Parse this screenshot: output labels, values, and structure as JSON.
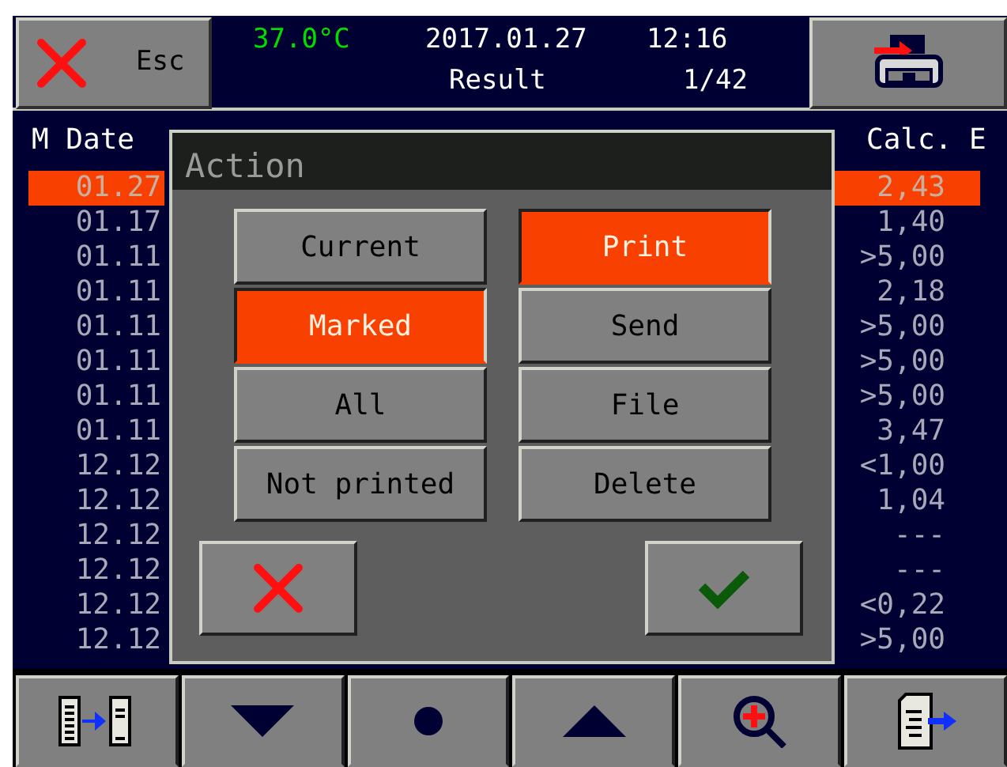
{
  "header": {
    "esc_label": "Esc",
    "temperature": "37.0°C",
    "date": "2017.01.27",
    "time": "12:16",
    "screen": "Result",
    "page": "1/42"
  },
  "table": {
    "columns": [
      "M Date",
      "Calc. E"
    ],
    "rows": [
      {
        "date": "01.27",
        "calc": "2,43",
        "selected": true
      },
      {
        "date": "01.17",
        "calc": "1,40",
        "selected": false
      },
      {
        "date": "01.11",
        "calc": ">5,00",
        "selected": false
      },
      {
        "date": "01.11",
        "calc": "2,18",
        "selected": false
      },
      {
        "date": "01.11",
        "calc": ">5,00",
        "selected": false
      },
      {
        "date": "01.11",
        "calc": ">5,00",
        "selected": false
      },
      {
        "date": "01.11",
        "calc": ">5,00",
        "selected": false
      },
      {
        "date": "01.11",
        "calc": "3,47",
        "selected": false
      },
      {
        "date": "12.12",
        "calc": "<1,00",
        "selected": false
      },
      {
        "date": "12.12",
        "calc": "1,04",
        "selected": false
      },
      {
        "date": "12.12",
        "calc": "---",
        "selected": false
      },
      {
        "date": "12.12",
        "calc": "---",
        "selected": false
      },
      {
        "date": "12.12",
        "calc": "<0,22",
        "selected": false
      },
      {
        "date": "12.12",
        "calc": ">5,00",
        "selected": false
      }
    ]
  },
  "dialog": {
    "title": "Action",
    "scope_options": [
      {
        "label": "Current",
        "selected": false
      },
      {
        "label": "Marked",
        "selected": true
      },
      {
        "label": "All",
        "selected": false
      },
      {
        "label": "Not printed",
        "selected": false
      }
    ],
    "actions": [
      {
        "label": "Print",
        "selected": true
      },
      {
        "label": "Send",
        "selected": false
      },
      {
        "label": "File",
        "selected": false
      },
      {
        "label": "Delete",
        "selected": false
      }
    ],
    "buttons": [
      {
        "kind": "cancel"
      },
      {
        "kind": "ok"
      }
    ]
  },
  "toolbar": [
    {
      "kind": "switch"
    },
    {
      "kind": "down"
    },
    {
      "kind": "dot"
    },
    {
      "kind": "up"
    },
    {
      "kind": "zoom"
    },
    {
      "kind": "export"
    }
  ]
}
